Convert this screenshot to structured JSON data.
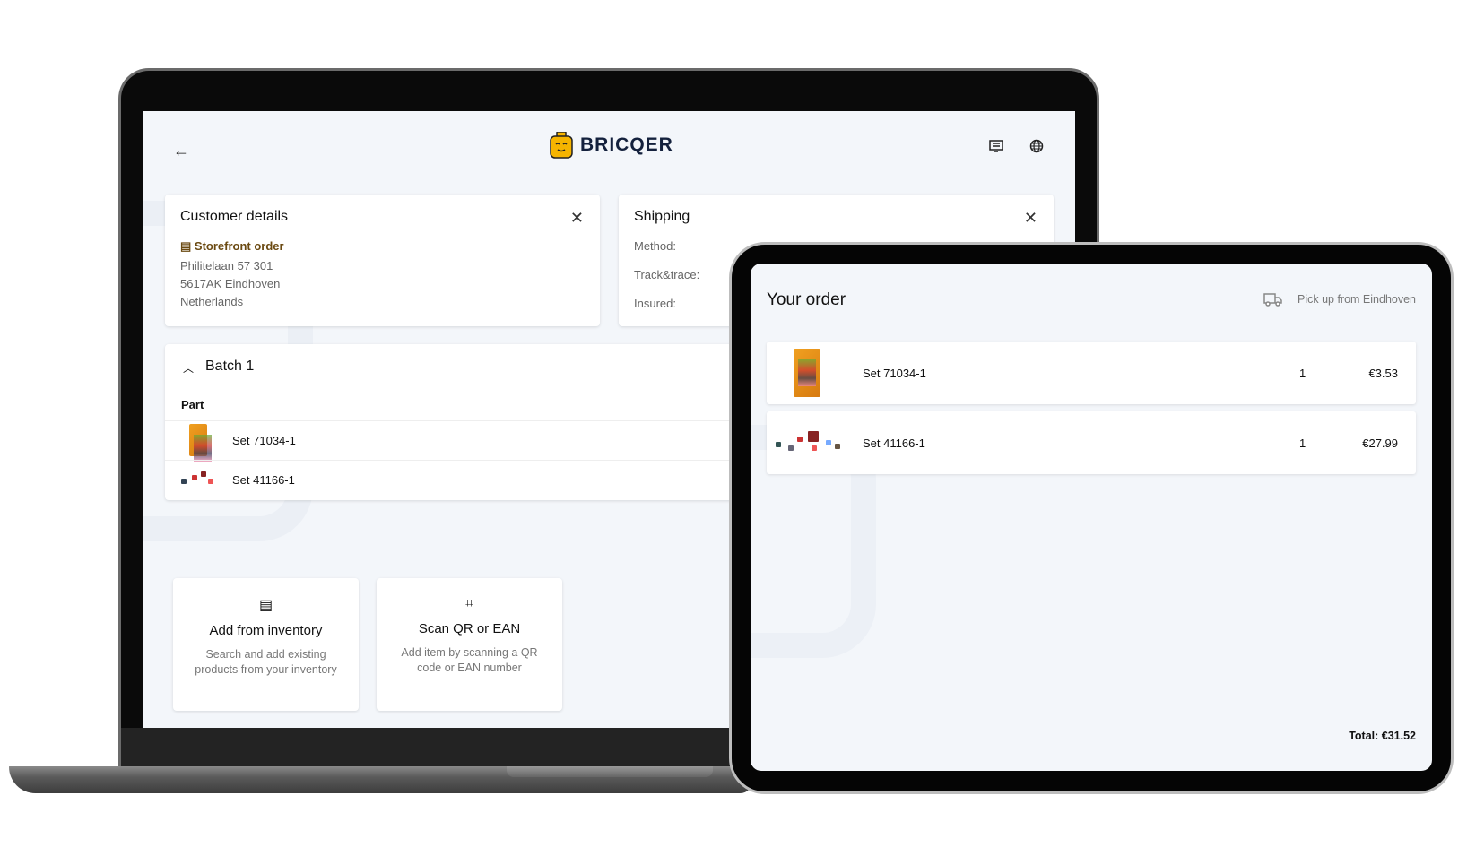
{
  "brand": {
    "name": "BRICQER",
    "accent": "#f5b400"
  },
  "header": {
    "back_icon": "arrow-left-icon",
    "right_icons": [
      "receipt-icon",
      "globe-icon"
    ]
  },
  "customer": {
    "title": "Customer details",
    "order_type": "Storefront order",
    "address": [
      "Philitelaan 57 301",
      "5617AK Eindhoven",
      "Netherlands"
    ],
    "order_type_color": "#6b4a12"
  },
  "shipping": {
    "title": "Shipping",
    "fields": [
      "Method:",
      "Track&trace:",
      "Insured:"
    ]
  },
  "batch": {
    "title": "Batch 1",
    "column": "Part",
    "items": [
      {
        "name": "Set 71034-1"
      },
      {
        "name": "Set 41166-1"
      }
    ]
  },
  "actions": [
    {
      "title": "Add from inventory",
      "description": "Search and add existing products from your inventory"
    },
    {
      "title": "Scan QR or EAN",
      "description": "Add item by scanning a QR code or EAN number"
    }
  ],
  "order": {
    "title": "Your order",
    "pickup": "Pick up from Eindhoven",
    "items": [
      {
        "name": "Set 71034-1",
        "qty": "1",
        "price": "€3.53"
      },
      {
        "name": "Set 41166-1",
        "qty": "1",
        "price": "€27.99"
      }
    ],
    "total": "Total: €31.52"
  }
}
